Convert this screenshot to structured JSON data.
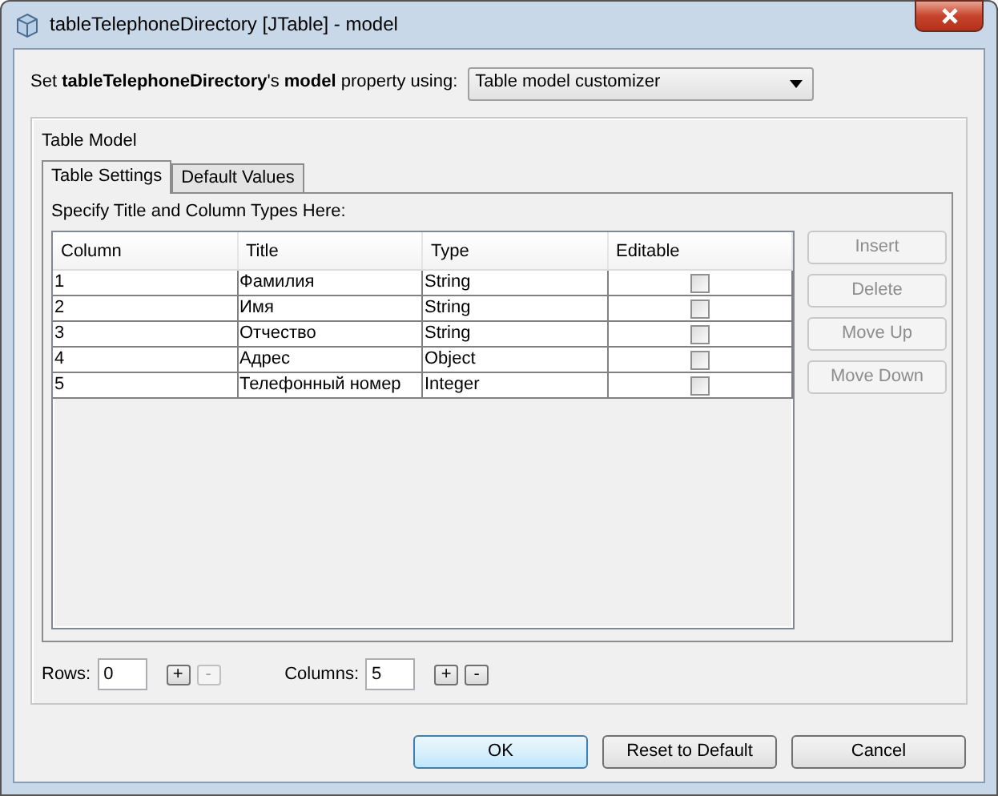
{
  "window": {
    "title": "tableTelephoneDirectory [JTable] - model"
  },
  "property_line": {
    "label": "Set **tableTelephoneDirectory**'s **model** property using:",
    "dropdown": "Table model customizer"
  },
  "group": {
    "title": "Table Model"
  },
  "tabs": [
    {
      "label": "Table Settings",
      "selected": true
    },
    {
      "label": "Default Values",
      "selected": false
    }
  ],
  "instruction": "Specify Title and Column Types Here:",
  "table": {
    "columns": [
      "Column",
      "Title",
      "Type",
      "Editable"
    ],
    "rows": [
      {
        "column": "1",
        "title": "Фамилия",
        "type": "String",
        "editable": false
      },
      {
        "column": "2",
        "title": "Имя",
        "type": "String",
        "editable": false
      },
      {
        "column": "3",
        "title": "Отчество",
        "type": "String",
        "editable": false
      },
      {
        "column": "4",
        "title": "Адрес",
        "type": "Object",
        "editable": false
      },
      {
        "column": "5",
        "title": "Телефонный номер",
        "type": "Integer",
        "editable": false
      }
    ]
  },
  "side_buttons": [
    {
      "label": "Insert",
      "disabled": true
    },
    {
      "label": "Delete",
      "disabled": true
    },
    {
      "label": "Move Up",
      "disabled": true
    },
    {
      "label": "Move Down",
      "disabled": true
    }
  ],
  "counters": [
    {
      "label": "Rows:",
      "value": "0",
      "plus": {
        "label": "+",
        "disabled": false
      },
      "minus": {
        "label": "-",
        "disabled": true
      }
    },
    {
      "label": "Columns:",
      "value": "5",
      "plus": {
        "label": "+",
        "disabled": false
      },
      "minus": {
        "label": "-",
        "disabled": false
      }
    }
  ],
  "buttons": [
    {
      "label": "OK",
      "default": true
    },
    {
      "label": "Reset to Default",
      "default": false
    },
    {
      "label": "Cancel",
      "default": false
    }
  ]
}
